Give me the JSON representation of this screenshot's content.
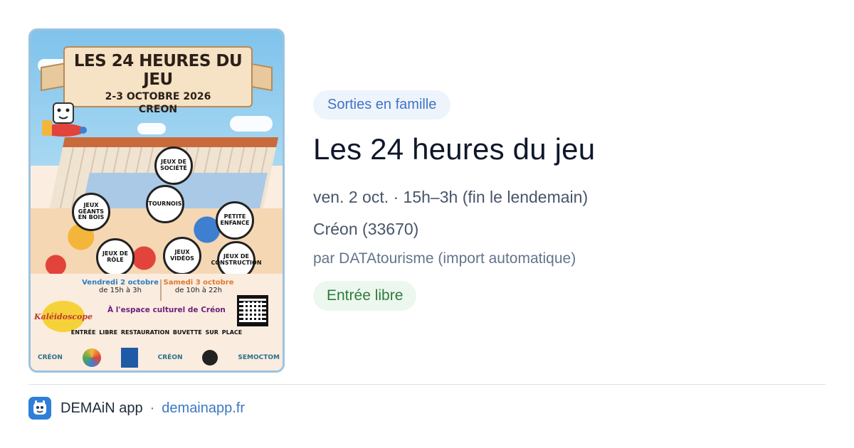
{
  "poster": {
    "title": "LES 24 HEURES DU JEU",
    "dates": "2-3 OCTOBRE 2026",
    "town": "CREON",
    "badges": [
      "JEUX DE SOCIÉTÉ",
      "TOURNOIS",
      "JEUX GÉANTS EN BOIS",
      "PETITE ENFANCE",
      "JEUX DE RÔLE",
      "JEUX VIDÉOS",
      "JEUX DE CONSTRUCTION"
    ],
    "day1": "Vendredi 2 octobre",
    "day1_hours": "de 15h à 3h",
    "day2": "Samedi 3 octobre",
    "day2_hours": "de 10h à 22h",
    "venue": "À l'espace culturel de Créon",
    "logo": "Kaléidoscope",
    "services": "ENTRÉE LIBRE   RESTAURATION   BUVETTE SUR PLACE",
    "sponsors": [
      "CRÉON",
      "CRÉON",
      "SEMOCTOM"
    ]
  },
  "category": "Sorties en famille",
  "title": "Les 24 heures du jeu",
  "date_line": "ven. 2 oct. · 15h–3h (fin le lendemain)",
  "place": "Créon (33670)",
  "source": "par DATAtourisme (import automatique)",
  "price": "Entrée libre",
  "footer": {
    "app_name": "DEMAiN app",
    "separator": "·",
    "url": "demainapp.fr",
    "icon": "demain-app-icon"
  }
}
